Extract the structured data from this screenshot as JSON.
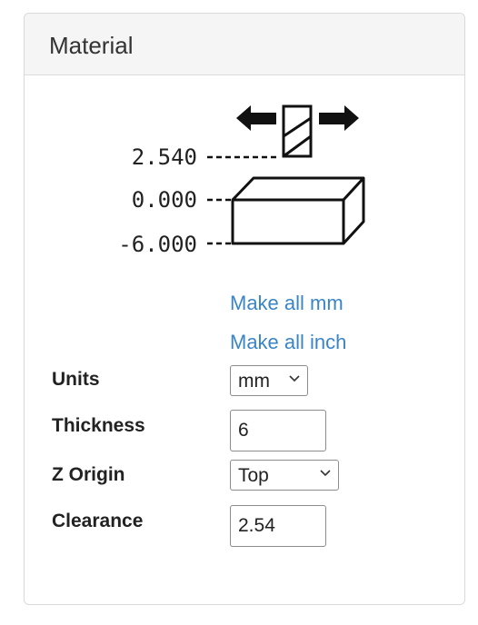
{
  "panel": {
    "title": "Material"
  },
  "diagram": {
    "clearance_readout": "2.540",
    "top_readout": "0.000",
    "bottom_readout": "-6.000"
  },
  "links": {
    "make_all_mm": "Make all mm",
    "make_all_inch": "Make all inch"
  },
  "fields": {
    "units": {
      "label": "Units",
      "value": "mm"
    },
    "thickness": {
      "label": "Thickness",
      "value": "6"
    },
    "z_origin": {
      "label": "Z Origin",
      "value": "Top"
    },
    "clearance": {
      "label": "Clearance",
      "value": "2.54"
    }
  },
  "icons": [
    "arrow-left-icon",
    "arrow-right-icon",
    "end-mill-icon",
    "stock-block-icon",
    "chevron-down-icon"
  ]
}
